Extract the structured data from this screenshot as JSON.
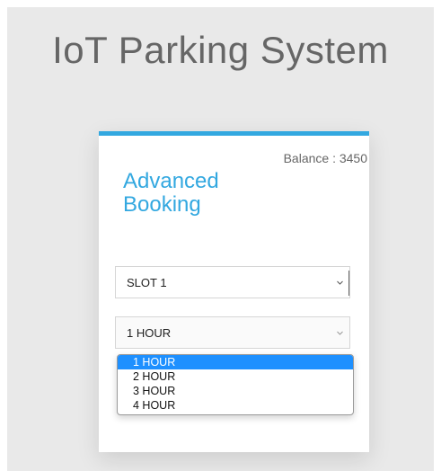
{
  "app": {
    "title": "IoT Parking System"
  },
  "booking": {
    "title": "Advanced Booking",
    "balance_text": "Balance : 3450"
  },
  "slot_select": {
    "selected": "SLOT 1"
  },
  "duration_select": {
    "selected": "1 HOUR",
    "options": [
      "1 HOUR",
      "2 HOUR",
      "3 HOUR",
      "4 HOUR"
    ],
    "highlighted_index": 0
  },
  "icons": {
    "select_arrow": "chevron-down-icon"
  },
  "colors": {
    "accent": "#33a8e0",
    "option_highlight": "#1e90ff",
    "page_bg": "#e9e9e9"
  }
}
